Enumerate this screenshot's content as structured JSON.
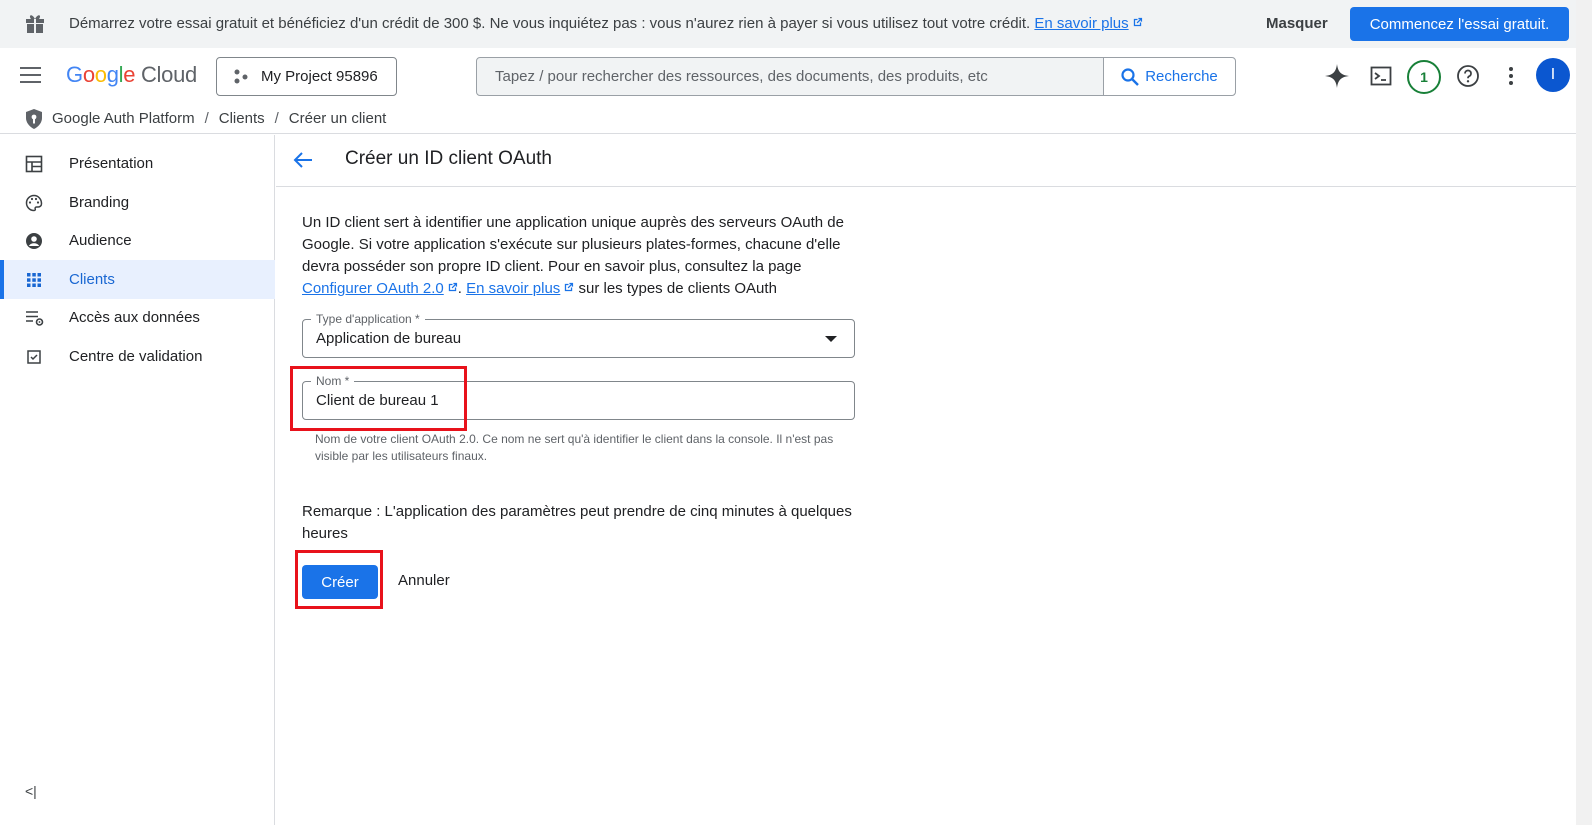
{
  "banner": {
    "message": "Démarrez votre essai gratuit et bénéficiez d'un crédit de 300 $. Ne vous inquiétez pas : vous n'aurez rien à payer si vous utilisez tout votre crédit.",
    "learn_more": "En savoir plus",
    "dismiss": "Masquer",
    "cta": "Commencez l'essai gratuit."
  },
  "header": {
    "logo_google": "Google",
    "logo_cloud": "Cloud",
    "project": "My Project 95896",
    "search_placeholder": "Tapez / pour rechercher des ressources, des documents, des produits, etc",
    "search_button": "Recherche",
    "notifications_count": "1",
    "avatar_initial": "I"
  },
  "breadcrumb": [
    "Google Auth Platform",
    "Clients",
    "Créer un client"
  ],
  "sidebar": {
    "items": [
      {
        "label": "Présentation",
        "icon": "dashboard-icon"
      },
      {
        "label": "Branding",
        "icon": "palette-icon"
      },
      {
        "label": "Audience",
        "icon": "account-circle-icon"
      },
      {
        "label": "Clients",
        "icon": "apps-grid-icon",
        "active": true
      },
      {
        "label": "Accès aux données",
        "icon": "data-settings-icon"
      },
      {
        "label": "Centre de validation",
        "icon": "verified-checkbox-icon"
      }
    ],
    "collapse": "<|"
  },
  "page": {
    "title": "Créer un ID client OAuth",
    "intro_text": "Un ID client sert à identifier une application unique auprès des serveurs OAuth de Google. Si votre application s'exécute sur plusieurs plates-formes, chacune d'elle devra posséder son propre ID client. Pour en savoir plus, consultez la page",
    "link_config": "Configurer OAuth 2.0",
    "link_more": "En savoir plus",
    "intro_tail": "sur les types de clients OAuth",
    "app_type_label": "Type d'application *",
    "app_type_value": "Application de bureau",
    "name_label": "Nom *",
    "name_value": "Client de bureau 1",
    "name_hint": "Nom de votre client OAuth 2.0. Ce nom ne sert qu'à identifier le client dans la console. Il n'est pas visible par les utilisateurs finaux.",
    "note": "Remarque : L'application des paramètres peut prendre de cinq minutes à quelques heures",
    "create_button": "Créer",
    "cancel_button": "Annuler"
  },
  "colors": {
    "accent": "#1a73e8",
    "highlight": "#e8121b",
    "active_bg": "#e8f0fe"
  }
}
